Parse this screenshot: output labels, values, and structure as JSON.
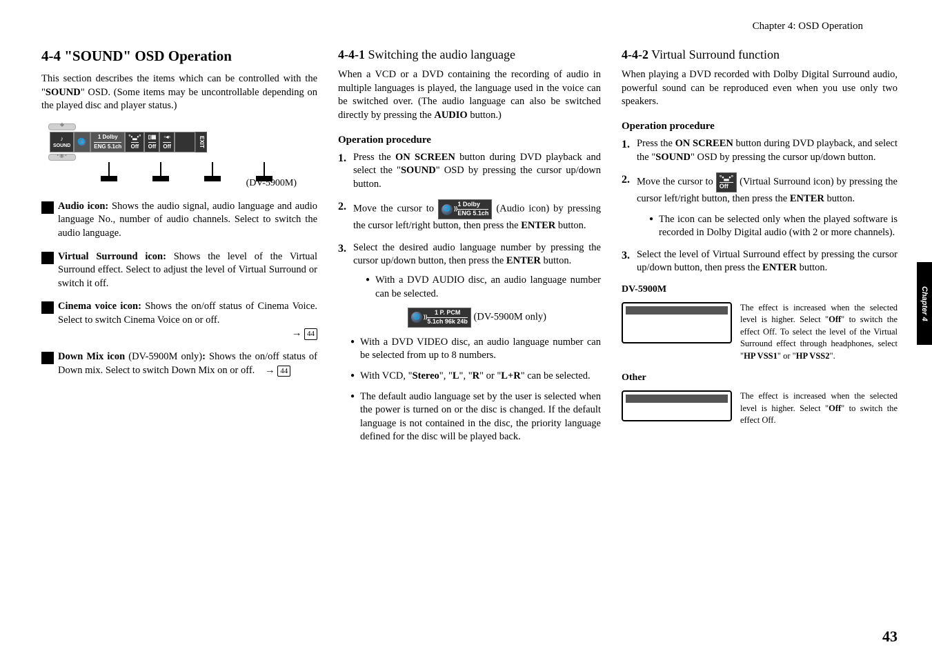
{
  "chapter_header": "Chapter 4: OSD Operation",
  "side_tab": "Chapter 4",
  "page_number": "43",
  "section": {
    "title": "4-4 \"SOUND\" OSD Operation",
    "intro": "This section describes the items which can be controlled with the \"SOUND\" OSD. (Some items may be uncontrollable depending on the played disc and player status.)"
  },
  "osd_diagram": {
    "cells": {
      "sound_icon": "♪",
      "sound_label": "SOUND",
      "audio_top": "1 Dolby",
      "audio_bot": "ENG 5.1ch",
      "vs_off": "Off",
      "cv_off": "Off",
      "dm_off": "Off",
      "exit": "EXIT"
    },
    "caption": "(DV-5900M)"
  },
  "icons": [
    {
      "name": "Audio icon:",
      "desc": " Shows the audio signal, audio language and audio language No., number of audio channels. Select to switch the audio language."
    },
    {
      "name": "Virtual Surround icon:",
      "desc": " Shows the level of the Virtual Surround effect. Select to adjust the level of Virtual Surround or switch it off."
    },
    {
      "name": "Cinema voice icon:",
      "desc": " Shows the on/off status of Cinema Voice. Select to switch Cinema Voice on or off.",
      "pageref": "44"
    },
    {
      "name": "Down Mix icon",
      "suffix": " (DV-5900M only)",
      "colon": ":",
      "desc": " Shows the on/off status of Down mix. Select to switch Down Mix on or off.",
      "pageref": "44",
      "pageref_inline": true
    }
  ],
  "sub441": {
    "num": "4-4-1",
    "title": "  Switching the audio language",
    "intro": "When a VCD or a DVD containing the recording of audio in multiple languages is played, the language used in the voice can be switched over. (The audio language can also be switched directly by pressing the AUDIO button.)",
    "op_proc_label": "Operation procedure",
    "steps": [
      {
        "pre": "Press the ",
        "b1": "ON SCREEN",
        "mid": " button during DVD playback and select the \"",
        "b2": "SOUND",
        "post": "\" OSD by pressing the cursor up/down button."
      },
      {
        "pre": "Move the cursor to ",
        "icon": {
          "top": "1 Dolby",
          "bot": "ENG 5.1ch"
        },
        "post": " (Audio icon) by pressing the cursor left/right button, then press the ",
        "b1": "ENTER",
        "post2": " button."
      },
      {
        "pre": "Select the desired audio language number by pressing the cursor up/down button, then press the ",
        "b1": "ENTER",
        "post": " button."
      }
    ],
    "step3_sub": "With a DVD AUDIO disc, an audio language number can be selected.",
    "center_icon": {
      "top": "1 P. PCM",
      "bot": "5.1ch 96k 24b",
      "suffix": " (DV-5900M only)"
    },
    "bullets": [
      "With a DVD VIDEO disc, an audio language number can be selected from up to 8 numbers.",
      {
        "pre": "With VCD, \"",
        "b1": "Stereo",
        "m1": "\", \"",
        "b2": "L",
        "m2": "\", \"",
        "b3": "R",
        "m3": "\" or \"",
        "b4": "L+R",
        "post": "\" can be selected."
      },
      "The default audio language set by the user is selected when the power is turned on or the disc is changed. If the default language is not contained in the disc, the priority language defined for the disc will be played back."
    ]
  },
  "sub442": {
    "num": "4-4-2",
    "title": "  Virtual Surround function",
    "intro": "When playing a DVD recorded with Dolby Digital Surround audio, powerful sound can be reproduced even when you use only two speakers.",
    "op_proc_label": "Operation procedure",
    "steps": [
      {
        "pre": "Press the ",
        "b1": "ON SCREEN",
        "mid": " button during DVD playback, and select the \"",
        "b2": "SOUND",
        "post": "\" OSD by pressing the cursor up/down button."
      },
      {
        "pre": "Move the cursor to ",
        "icon_off": "Off",
        "post": " (Virtual Surround icon) by pressing the cursor left/right button, then press the ",
        "b1": "ENTER",
        "post2": " button."
      }
    ],
    "step2_sub": "The icon can be selected only when the played software is recorded in Dolby Digital audio (with 2 or more channels).",
    "step3": {
      "pre": "Select the level of Virtual Surround effect by pressing the cursor up/down button, then press the ",
      "b1": "ENTER",
      "post": " button."
    },
    "dv_label": "DV-5900M",
    "dv_desc_pre": "The effect is increased when the selected level is higher. Select \"",
    "dv_desc_b1": "Off",
    "dv_desc_mid": "\" to switch the effect Off. To select the level of the Virtual Surround effect through headphones, select \"",
    "dv_desc_b2": "HP VSS1",
    "dv_desc_mid2": "\" or \"",
    "dv_desc_b3": "HP VSS2",
    "dv_desc_post": "\".",
    "other_label": "Other",
    "other_desc_pre": "The effect is increased when the selected level is higher. Select \"",
    "other_desc_b1": "Off",
    "other_desc_post": "\" to switch the effect Off."
  }
}
